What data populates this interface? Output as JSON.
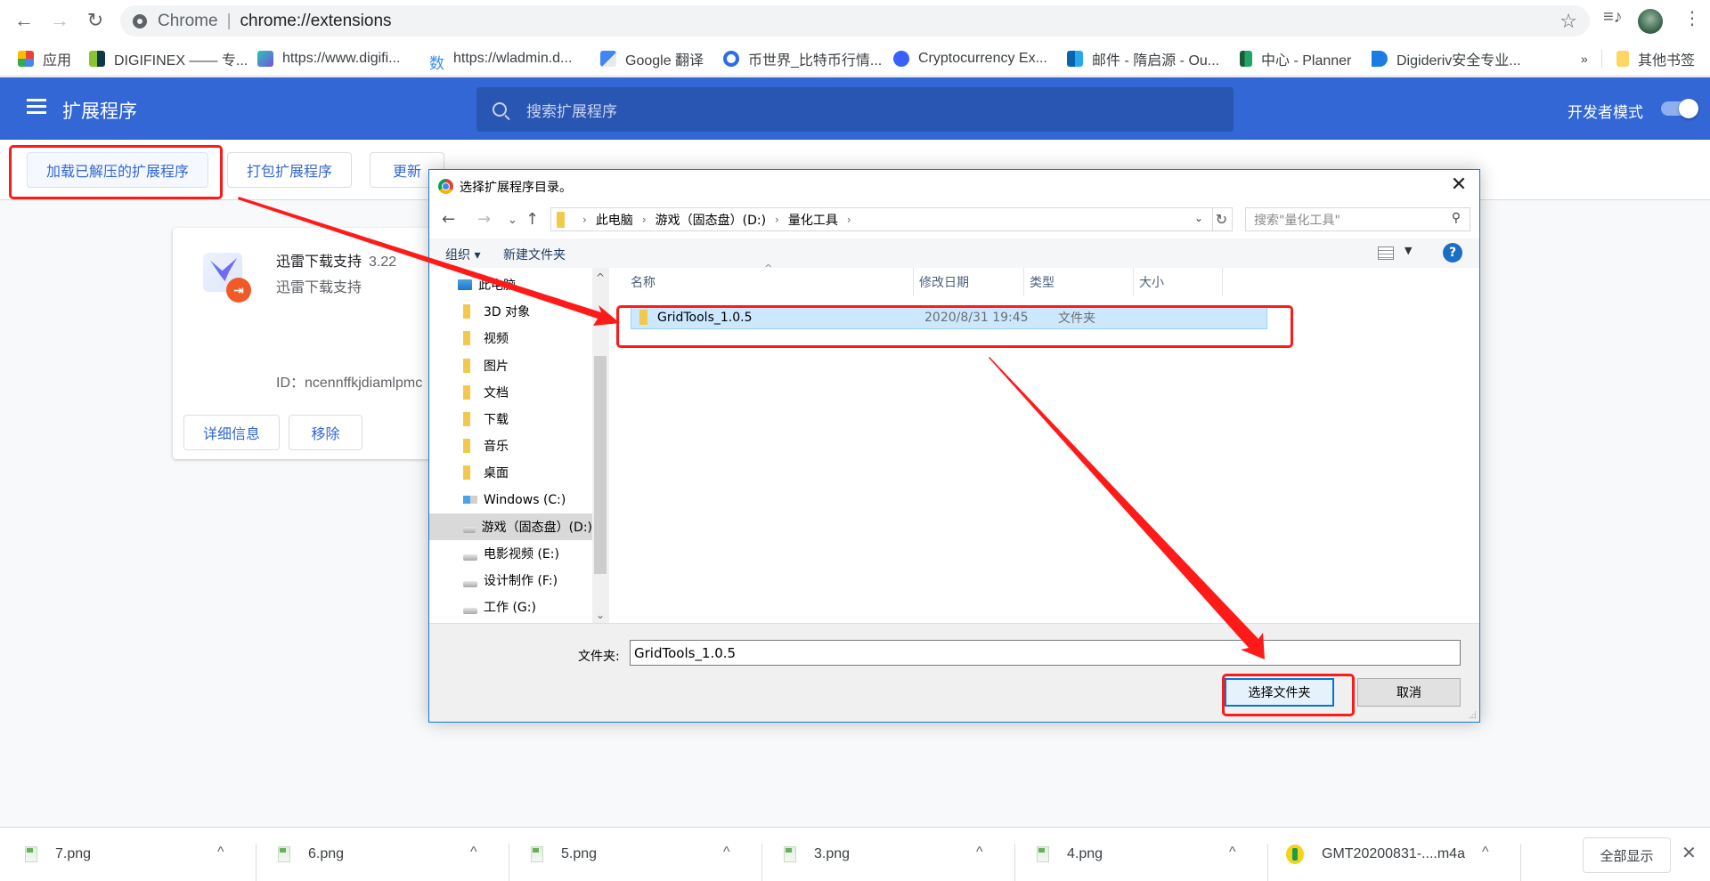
{
  "browser": {
    "omnibox": {
      "scheme_label": "Chrome",
      "url": "chrome://extensions"
    },
    "icons": [
      "back-arrow-icon",
      "forward-arrow-icon",
      "reload-icon",
      "star-icon",
      "media-control-icon",
      "avatar",
      "more-vert-icon"
    ],
    "glyphs": {
      "back": "←",
      "forward": "→",
      "reload": "↻",
      "star": "☆",
      "media": "≡♪",
      "more": "⋮"
    }
  },
  "bookmarks": [
    {
      "label": "应用",
      "icon": "apps-grid-icon"
    },
    {
      "label": "DIGIFINEX —— 专...",
      "icon": "digifinex-icon"
    },
    {
      "label": "https://www.digifi...",
      "icon": "digifi-icon"
    },
    {
      "label": "https://wladmin.d...",
      "icon": "shu-icon",
      "icon_text": "数"
    },
    {
      "label": "Google 翻译",
      "icon": "google-translate-icon"
    },
    {
      "label": "币世界_比特币行情...",
      "icon": "bishijie-icon"
    },
    {
      "label": "Cryptocurrency Ex...",
      "icon": "coinmarket-icon"
    },
    {
      "label": "邮件 - 隋启源 - Ou...",
      "icon": "outlook-icon"
    },
    {
      "label": "中心 - Planner",
      "icon": "planner-icon"
    },
    {
      "label": "Digideriv安全专业...",
      "icon": "digideriv-icon"
    }
  ],
  "bookmarks_overflow": "»",
  "other_bookmarks": "其他书签",
  "extensions_page": {
    "title": "扩展程序",
    "search_placeholder": "搜索扩展程序",
    "developer_mode_label": "开发者模式",
    "developer_mode_on": true,
    "actions": {
      "load_unpacked": "加载已解压的扩展程序",
      "pack": "打包扩展程序",
      "update": "更新"
    },
    "extension": {
      "name": "迅雷下载支持",
      "version": "3.22",
      "description": "迅雷下载支持",
      "id_text": "ID：ncennffkjdiamlpmc",
      "details_label": "详细信息",
      "remove_label": "移除"
    }
  },
  "dialog": {
    "title": "选择扩展程序目录。",
    "close_glyph": "✕",
    "nav": {
      "back": "←",
      "forward": "→",
      "recent": "⌄",
      "up": "↑"
    },
    "path": [
      "此电脑",
      "游戏（固态盘）(D:)",
      "量化工具"
    ],
    "search_placeholder": "搜索\"量化工具\"",
    "toolbar": {
      "organize": "组织 ▾",
      "new_folder": "新建文件夹",
      "help": "?"
    },
    "tree": [
      {
        "label": "此电脑",
        "icon": "pc",
        "indent": 0
      },
      {
        "label": "3D 对象",
        "icon": "folder",
        "indent": 1
      },
      {
        "label": "视频",
        "icon": "folder",
        "indent": 1
      },
      {
        "label": "图片",
        "icon": "folder",
        "indent": 1
      },
      {
        "label": "文档",
        "icon": "folder",
        "indent": 1
      },
      {
        "label": "下载",
        "icon": "folder",
        "indent": 1
      },
      {
        "label": "音乐",
        "icon": "folder",
        "indent": 1
      },
      {
        "label": "桌面",
        "icon": "folder",
        "indent": 1
      },
      {
        "label": "Windows (C:)",
        "icon": "win",
        "indent": 1
      },
      {
        "label": "游戏（固态盘）(D:)",
        "icon": "drive",
        "indent": 1,
        "selected": true
      },
      {
        "label": "电影视频 (E:)",
        "icon": "drive",
        "indent": 1
      },
      {
        "label": "设计制作 (F:)",
        "icon": "drive",
        "indent": 1
      },
      {
        "label": "工作 (G:)",
        "icon": "drive",
        "indent": 1
      }
    ],
    "columns": [
      "名称",
      "修改日期",
      "类型",
      "大小"
    ],
    "files": [
      {
        "name": "GridTools_1.0.5",
        "modified": "2020/8/31 19:45",
        "type": "文件夹",
        "size": "",
        "selected": true
      }
    ],
    "folder_label": "文件夹:",
    "folder_value": "GridTools_1.0.5",
    "select_button": "选择文件夹",
    "cancel_button": "取消"
  },
  "annotations": {
    "color": "#ff1a1a"
  },
  "downloads": {
    "items": [
      {
        "name": "7.png",
        "type": "png"
      },
      {
        "name": "6.png",
        "type": "png"
      },
      {
        "name": "5.png",
        "type": "png"
      },
      {
        "name": "3.png",
        "type": "png"
      },
      {
        "name": "4.png",
        "type": "png"
      },
      {
        "name": "GMT20200831-....m4a",
        "type": "audio"
      }
    ],
    "show_all": "全部显示",
    "close_glyph": "✕",
    "caret_glyph": "^"
  },
  "colors": {
    "chrome_blue": "#3367d6",
    "selection": "#cce8ff",
    "dialog_border": "#1979ca"
  }
}
